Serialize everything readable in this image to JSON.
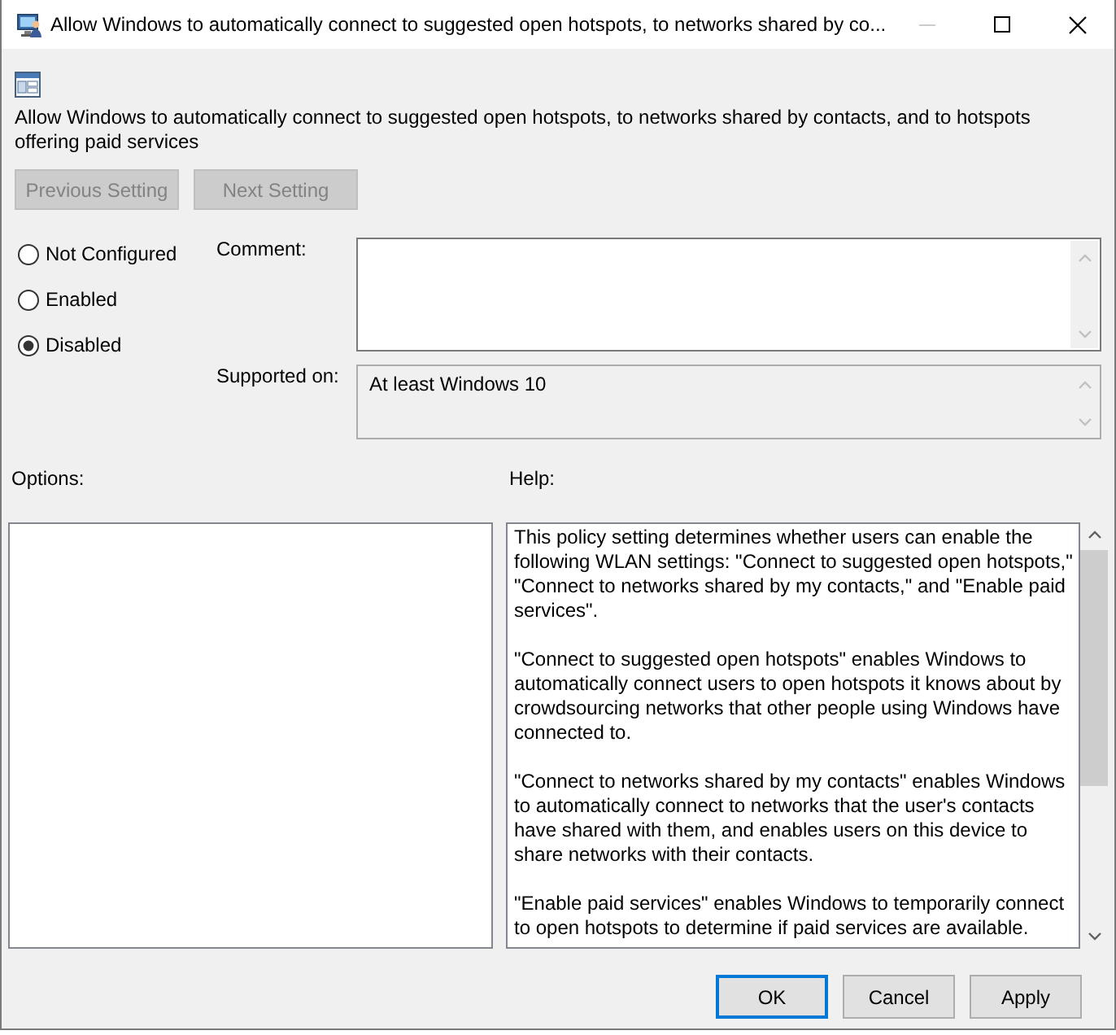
{
  "window": {
    "title": "Allow Windows to automatically connect to suggested open hotspots, to networks shared by co...",
    "controls": [
      {
        "kind": "minimize",
        "disabled": true
      },
      {
        "kind": "maximize",
        "disabled": false
      },
      {
        "kind": "close",
        "disabled": false
      }
    ]
  },
  "heading": "Allow Windows to automatically connect to suggested open hotspots, to networks shared by contacts, and to hotspots offering paid services",
  "nav_buttons": [
    {
      "label": "Previous Setting",
      "disabled": true
    },
    {
      "label": "Next Setting",
      "disabled": true
    }
  ],
  "state_options": [
    {
      "label": "Not Configured",
      "selected": false
    },
    {
      "label": "Enabled",
      "selected": false
    },
    {
      "label": "Disabled",
      "selected": true
    }
  ],
  "comment": {
    "label": "Comment:"
  },
  "supported_on": {
    "label": "Supported on:",
    "value": "At least Windows 10"
  },
  "options": {
    "label": "Options:"
  },
  "help": {
    "label": "Help:",
    "paragraphs": [
      "This policy setting determines whether users can enable the following WLAN settings: \"Connect to suggested open hotspots,\" \"Connect to networks shared by my contacts,\" and \"Enable paid services\".",
      "\"Connect to suggested open hotspots\" enables Windows to automatically connect users to open hotspots it knows about by crowdsourcing networks that other people using Windows have connected to.",
      "\"Connect to networks shared by my contacts\" enables Windows to automatically connect to networks that the user's contacts have shared with them, and enables users on this device to share networks with their contacts.",
      "\"Enable paid services\" enables Windows to temporarily connect to open hotspots to determine if paid services are available."
    ]
  },
  "buttons": [
    {
      "label": "OK",
      "default": true
    },
    {
      "label": "Cancel",
      "default": false
    },
    {
      "label": "Apply",
      "default": false
    }
  ]
}
